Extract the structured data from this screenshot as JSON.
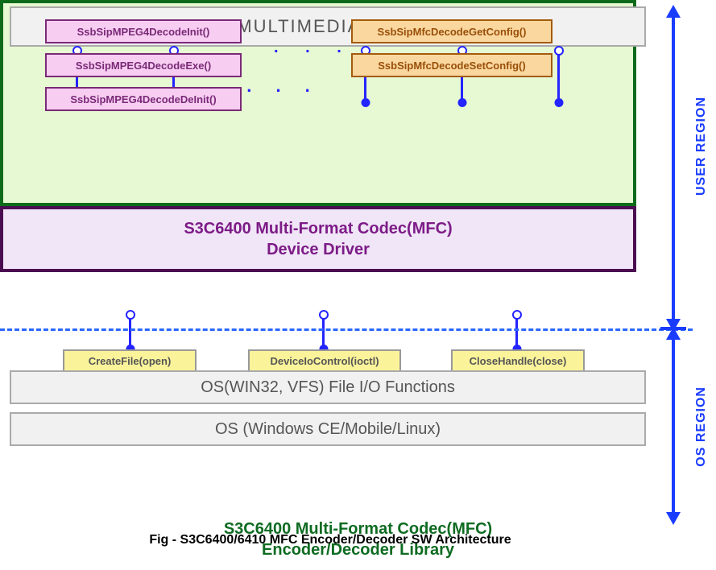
{
  "app": {
    "title": "USER'S MULTIMEDIA  APPLICATION"
  },
  "library": {
    "title_line1": "S3C6400 Multi-Format Codec(MFC)",
    "title_line2": "Encoder/Decoder Library",
    "pink": [
      "SsbSipMPEG4DecodeInit()",
      "SsbSipMPEG4DecodeExe()",
      "SsbSipMPEG4DecodeDeInit()"
    ],
    "orange": [
      "SsbSipMfcDecodeGetConfig()",
      "SsbSipMfcDecodeSetConfig()"
    ]
  },
  "fileio": {
    "calls": [
      "CreateFile(open)",
      "DeviceIoControl(ioctl)",
      "CloseHandle(close)"
    ],
    "layer": "OS(WIN32, VFS) File I/O Functions"
  },
  "os": {
    "layer": "OS (Windows CE/Mobile/Linux)"
  },
  "driver": {
    "title_line1": "S3C6400 Multi-Format Codec(MFC)",
    "title_line2": "Device Driver"
  },
  "regions": {
    "user": "USER REGION",
    "os": "OS REGION"
  },
  "caption": "Fig - S3C6400/6410 MFC Encoder/Decoder SW Architecture",
  "ellipsis": ". . .",
  "ellipsis_wide": ".   .   .   ."
}
